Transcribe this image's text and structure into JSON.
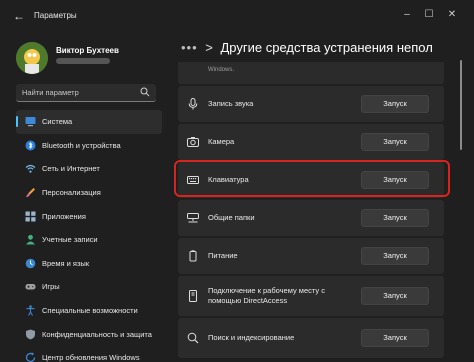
{
  "window": {
    "title": "Параметры",
    "controls": [
      "minimize",
      "maximize",
      "close"
    ]
  },
  "user": {
    "name": "Виктор Бухтеев"
  },
  "search": {
    "placeholder": "Найти параметр"
  },
  "sidebar": {
    "items": [
      {
        "label": "Система",
        "icon": "monitor-icon",
        "active": true
      },
      {
        "label": "Bluetooth и устройства",
        "icon": "bluetooth-icon"
      },
      {
        "label": "Сеть и Интернет",
        "icon": "wifi-icon"
      },
      {
        "label": "Персонализация",
        "icon": "brush-icon"
      },
      {
        "label": "Приложения",
        "icon": "apps-icon"
      },
      {
        "label": "Учетные записи",
        "icon": "person-icon"
      },
      {
        "label": "Время и язык",
        "icon": "globe-clock-icon"
      },
      {
        "label": "Игры",
        "icon": "gamepad-icon"
      },
      {
        "label": "Специальные возможности",
        "icon": "accessibility-icon"
      },
      {
        "label": "Конфиденциальность и защита",
        "icon": "shield-icon"
      },
      {
        "label": "Центр обновления Windows",
        "icon": "update-icon"
      }
    ],
    "accent_color": "#4cc2ff"
  },
  "breadcrumb": {
    "dots": "•••",
    "separator": ">",
    "title": "Другие средства устранения непол"
  },
  "main": {
    "top_row_desc": "Windows.",
    "rows": [
      {
        "label": "Запись звука",
        "icon": "microphone-icon",
        "button": "Запуск"
      },
      {
        "label": "Камера",
        "icon": "camera-icon",
        "button": "Запуск"
      },
      {
        "label": "Клавиатура",
        "icon": "keyboard-icon",
        "button": "Запуск",
        "highlighted": true
      },
      {
        "label": "Общие папки",
        "icon": "network-drive-icon",
        "button": "Запуск"
      },
      {
        "label": "Питание",
        "icon": "power-icon",
        "button": "Запуск"
      },
      {
        "label": "Подключение к рабочему месту с помощью DirectAccess",
        "icon": "directaccess-icon",
        "button": "Запуск"
      },
      {
        "label": "Поиск и индексирование",
        "icon": "search-icon",
        "button": "Запуск"
      }
    ],
    "highlight_color": "#d9231f"
  }
}
